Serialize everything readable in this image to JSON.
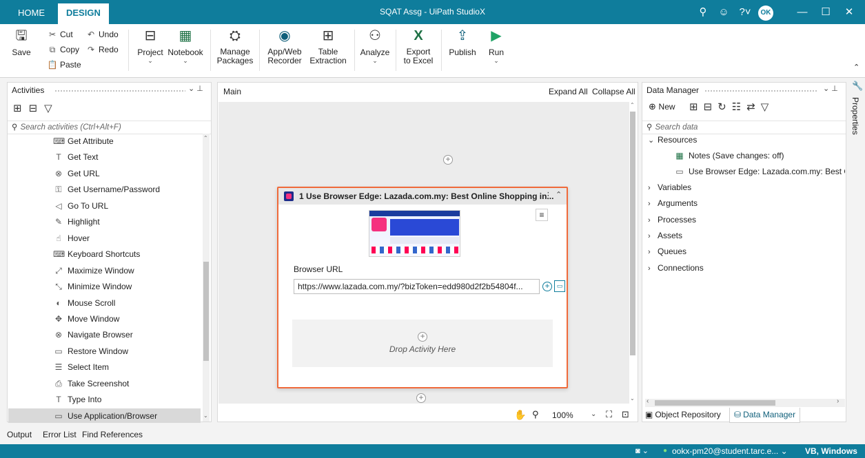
{
  "titlebar": {
    "tabs": [
      "HOME",
      "DESIGN"
    ],
    "title": "SQAT Assg - UiPath StudioX",
    "user_initials": "OK"
  },
  "ribbon": {
    "save": "Save",
    "cut": "Cut",
    "copy": "Copy",
    "paste": "Paste",
    "undo": "Undo",
    "redo": "Redo",
    "project": "Project",
    "notebook": "Notebook",
    "manage_packages": [
      "Manage",
      "Packages"
    ],
    "app_web_recorder": [
      "App/Web",
      "Recorder"
    ],
    "table_extraction": [
      "Table",
      "Extraction"
    ],
    "analyze": "Analyze",
    "export_to_excel": [
      "Export",
      "to Excel"
    ],
    "publish": "Publish",
    "run": "Run"
  },
  "activities": {
    "title": "Activities",
    "search_placeholder": "Search activities (Ctrl+Alt+F)",
    "items": [
      {
        "label": "Get Attribute",
        "icon": "get-attribute-icon"
      },
      {
        "label": "Get Text",
        "icon": "get-text-icon"
      },
      {
        "label": "Get URL",
        "icon": "get-url-icon"
      },
      {
        "label": "Get Username/Password",
        "icon": "get-username-password-icon"
      },
      {
        "label": "Go To URL",
        "icon": "go-to-url-icon"
      },
      {
        "label": "Highlight",
        "icon": "highlight-icon"
      },
      {
        "label": "Hover",
        "icon": "hover-icon"
      },
      {
        "label": "Keyboard Shortcuts",
        "icon": "keyboard-icon"
      },
      {
        "label": "Maximize Window",
        "icon": "maximize-window-icon"
      },
      {
        "label": "Minimize Window",
        "icon": "minimize-window-icon"
      },
      {
        "label": "Mouse Scroll",
        "icon": "mouse-scroll-icon"
      },
      {
        "label": "Move Window",
        "icon": "move-window-icon"
      },
      {
        "label": "Navigate Browser",
        "icon": "navigate-browser-icon"
      },
      {
        "label": "Restore Window",
        "icon": "restore-window-icon"
      },
      {
        "label": "Select Item",
        "icon": "select-item-icon"
      },
      {
        "label": "Take Screenshot",
        "icon": "take-screenshot-icon"
      },
      {
        "label": "Type Into",
        "icon": "type-into-icon"
      },
      {
        "label": "Use Application/Browser",
        "icon": "use-application-browser-icon"
      }
    ]
  },
  "designer": {
    "tab": "Main",
    "expand_all": "Expand All",
    "collapse_all": "Collapse All",
    "card_title": "1 Use Browser Edge: Lazada.com.my: Best Online Shopping in...",
    "browser_url_label": "Browser URL",
    "browser_url_value": "https://www.lazada.com.my/?bizToken=edd980d2f2b54804f...",
    "drop_text": "Drop Activity Here",
    "zoom": "100%"
  },
  "data_manager": {
    "title": "Data Manager",
    "new_label": "New",
    "search_placeholder": "Search data",
    "resources_label": "Resources",
    "resources_children": [
      {
        "label": "Notes (Save changes: off)",
        "icon": "excel-notebook-icon"
      },
      {
        "label": "Use Browser Edge: Lazada.com.my: Best Onl",
        "icon": "browser-icon"
      }
    ],
    "groups": [
      "Variables",
      "Arguments",
      "Processes",
      "Assets",
      "Queues",
      "Connections"
    ],
    "bottom_tabs": [
      "Object Repository",
      "Data Manager"
    ]
  },
  "properties_label": "Properties",
  "bottom_tabs": [
    "Output",
    "Error List",
    "Find References"
  ],
  "status": {
    "account": "ookx-pm20@student.tarc.e...",
    "language": "VB, Windows"
  },
  "colors": {
    "accent": "#0f7d9c",
    "selection_border": "#f06a3a"
  }
}
